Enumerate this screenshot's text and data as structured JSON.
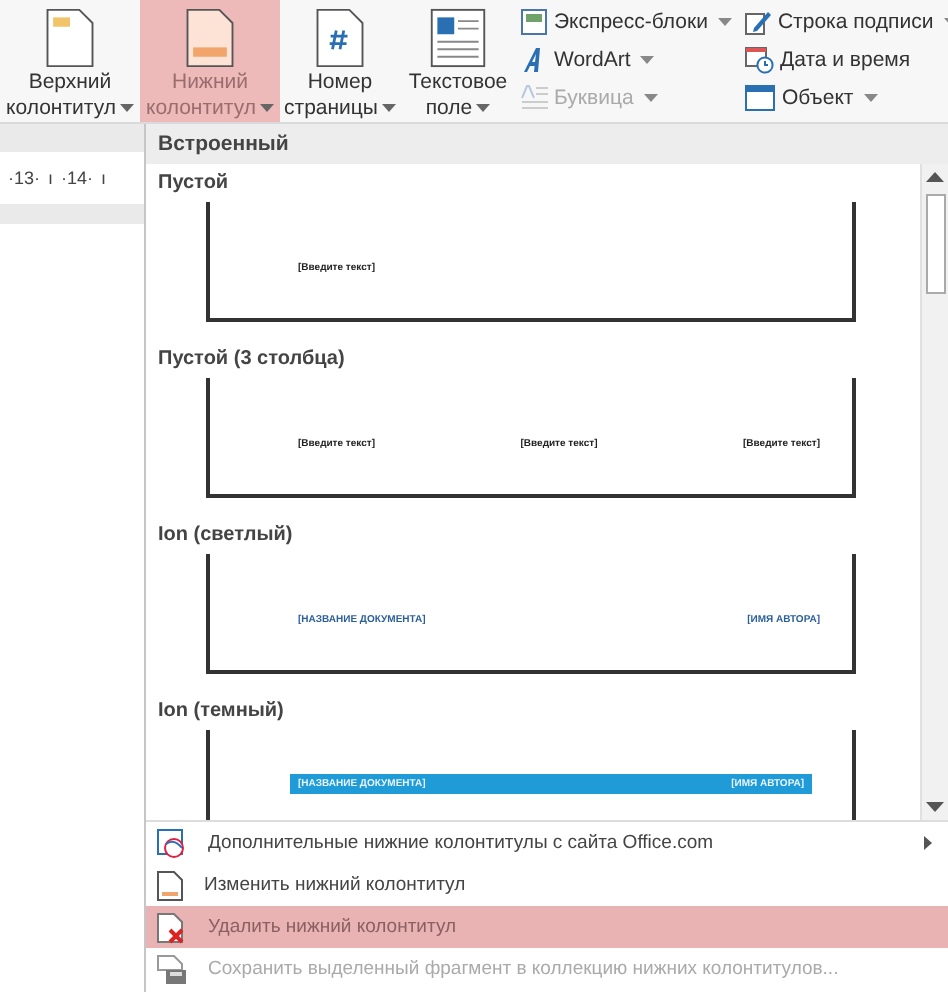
{
  "ribbon": {
    "large_buttons": [
      {
        "lines": [
          "Верхний",
          "колонтитул"
        ],
        "dropdown": true,
        "selected": false
      },
      {
        "lines": [
          "Нижний",
          "колонтитул"
        ],
        "dropdown": true,
        "selected": true
      },
      {
        "lines": [
          "Номер",
          "страницы"
        ],
        "dropdown": true,
        "selected": false
      },
      {
        "lines": [
          "Текстовое",
          "поле"
        ],
        "dropdown": true,
        "selected": false
      }
    ],
    "small_columns": [
      [
        {
          "label": "Экспресс-блоки",
          "dropdown": true,
          "disabled": false
        },
        {
          "label": "WordArt",
          "dropdown": true,
          "disabled": false
        },
        {
          "label": "Буквица",
          "dropdown": true,
          "disabled": true
        }
      ],
      [
        {
          "label": "Строка подписи",
          "dropdown": true,
          "disabled": false
        },
        {
          "label": "Дата и время",
          "dropdown": false,
          "disabled": false
        },
        {
          "label": "Объект",
          "dropdown": true,
          "disabled": false
        }
      ]
    ]
  },
  "ruler": {
    "marks": [
      "·13·",
      "ı",
      "·14·",
      "ı"
    ]
  },
  "dropdown": {
    "section": "Встроенный",
    "gallery": [
      {
        "title": "Пустой",
        "kind": "blank",
        "texts": [
          "[Введите текст]"
        ]
      },
      {
        "title": "Пустой (3 столбца)",
        "kind": "three",
        "texts": [
          "[Введите текст]",
          "[Введите текст]",
          "[Введите текст]"
        ]
      },
      {
        "title": "Ion (светлый)",
        "kind": "light",
        "texts": [
          "[НАЗВАНИЕ ДОКУМЕНТА]",
          "[ИМЯ АВТОРА]"
        ]
      },
      {
        "title": "Ion (темный)",
        "kind": "dark",
        "texts": [
          "[НАЗВАНИЕ ДОКУМЕНТА]",
          "[ИМЯ АВТОРА]"
        ]
      }
    ],
    "menu": [
      {
        "label": "Дополнительные нижние колонтитулы с сайта Office.com",
        "submenu": true,
        "selected": false,
        "disabled": false
      },
      {
        "label": "Изменить нижний колонтитул",
        "submenu": false,
        "selected": false,
        "disabled": false
      },
      {
        "label": "Удалить нижний колонтитул",
        "submenu": false,
        "selected": true,
        "disabled": false
      },
      {
        "label": "Сохранить выделенный фрагмент в коллекцию нижних колонтитулов...",
        "submenu": false,
        "selected": false,
        "disabled": true
      }
    ]
  }
}
